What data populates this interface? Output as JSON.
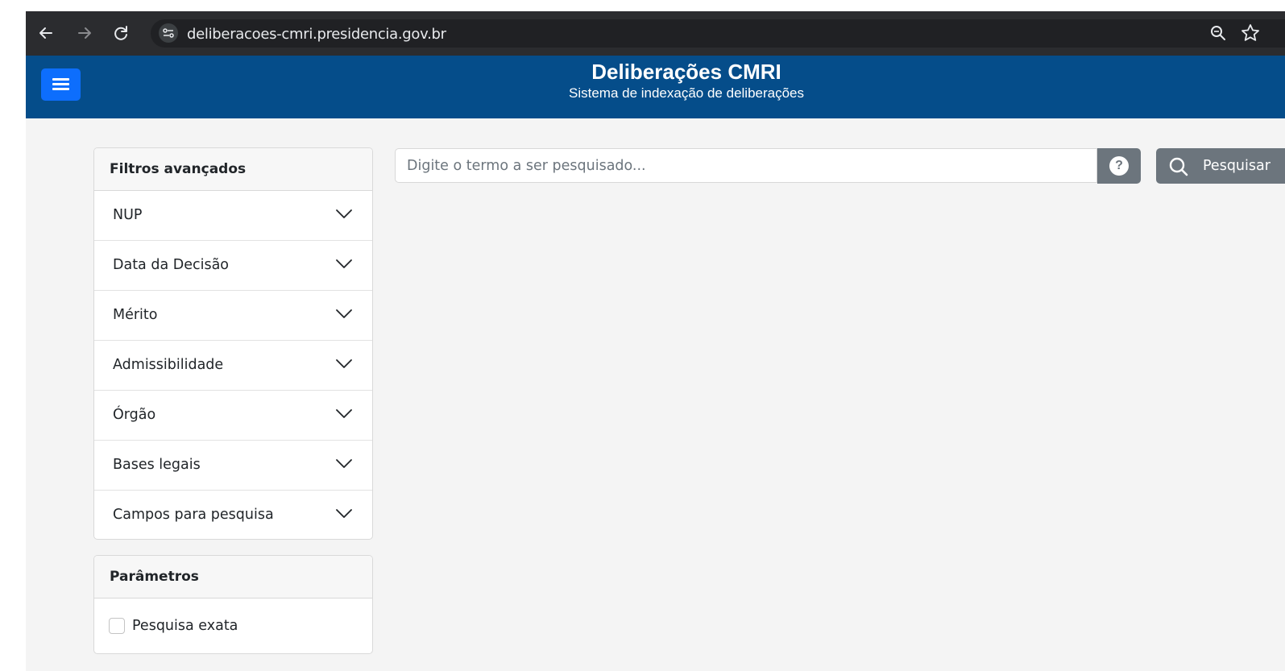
{
  "browser": {
    "url": "deliberacoes-cmri.presidencia.gov.br",
    "icons": [
      "back-arrow-icon",
      "forward-arrow-icon",
      "reload-icon",
      "site-info-icon",
      "zoom-icon",
      "bookmark-star-icon"
    ]
  },
  "header": {
    "title": "Deliberações CMRI",
    "subtitle": "Sistema de indexação de deliberações",
    "background": "#054d8a",
    "menu_icon": "hamburger-menu-icon",
    "menu_color": "#0d6efd"
  },
  "filters": {
    "title": "Filtros avançados",
    "items": [
      {
        "label": "NUP"
      },
      {
        "label": "Data da Decisão"
      },
      {
        "label": "Mérito"
      },
      {
        "label": "Admissibilidade"
      },
      {
        "label": "Órgão"
      },
      {
        "label": "Bases legais"
      },
      {
        "label": "Campos para pesquisa"
      }
    ],
    "expand_icon": "chevron-down-icon"
  },
  "parameters": {
    "title": "Parâmetros",
    "exact_search": {
      "label": "Pesquisa exata",
      "checked": false
    }
  },
  "search": {
    "placeholder": "Digite o termo a ser pesquisado...",
    "value": "",
    "help_icon": "question-circle-icon",
    "button_label": "Pesquisar",
    "button_icon": "search-icon",
    "button_color": "#6c757d"
  }
}
